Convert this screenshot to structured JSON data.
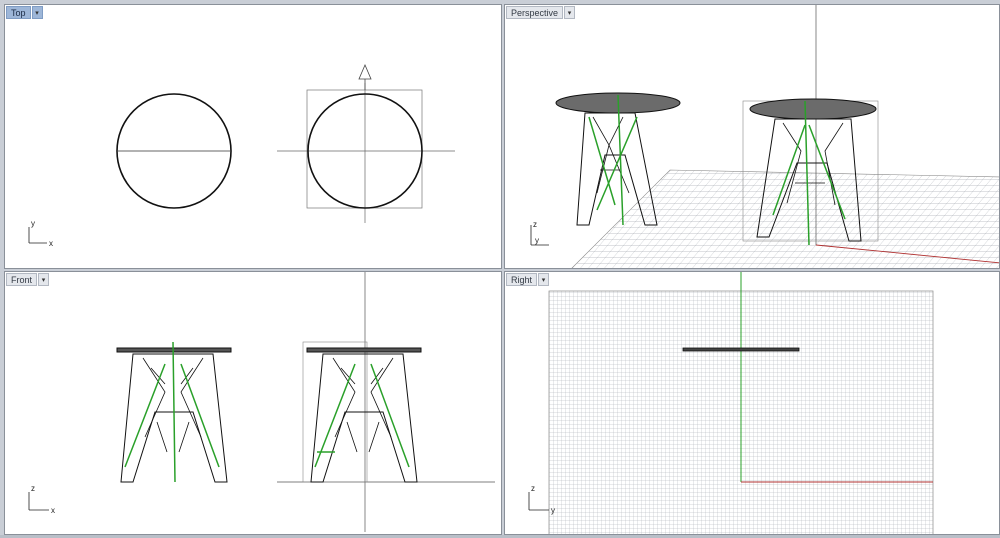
{
  "viewports": {
    "top": {
      "label": "Top"
    },
    "perspective": {
      "label": "Perspective"
    },
    "front": {
      "label": "Front"
    },
    "right": {
      "label": "Right"
    }
  },
  "axes": {
    "top": {
      "horizontal": "x",
      "vertical": "y"
    },
    "perspective": {
      "horizontal": "y",
      "vertical": "z"
    },
    "front": {
      "horizontal": "x",
      "vertical": "z"
    },
    "right": {
      "horizontal": "y",
      "vertical": "z"
    }
  },
  "icons": {
    "viewport_menu": "chevron-down-icon"
  },
  "colors": {
    "active_tab": "#9db6d8",
    "curve": "#111111",
    "selected_curve": "#2aa02a",
    "x_axis": "#b03030",
    "grid": "#9aa0a8",
    "tabletop_fill": "#6b6b6b"
  }
}
